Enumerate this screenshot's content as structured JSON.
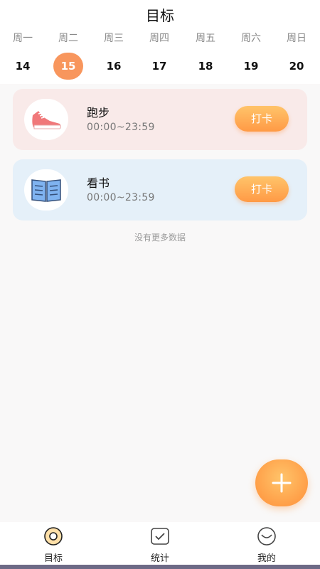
{
  "header": {
    "title": "目标"
  },
  "week": {
    "days": [
      {
        "weekday": "周一",
        "date": "14"
      },
      {
        "weekday": "周二",
        "date": "15"
      },
      {
        "weekday": "周三",
        "date": "16"
      },
      {
        "weekday": "周四",
        "date": "17"
      },
      {
        "weekday": "周五",
        "date": "18"
      },
      {
        "weekday": "周六",
        "date": "19"
      },
      {
        "weekday": "周日",
        "date": "20"
      }
    ],
    "selected_date": "15"
  },
  "goals": [
    {
      "name": "跑步",
      "time": "00:00~23:59",
      "button": "打卡",
      "icon": "sneaker-icon",
      "color": "#f9eae9"
    },
    {
      "name": "看书",
      "time": "00:00~23:59",
      "button": "打卡",
      "icon": "book-icon",
      "color": "#e5f0f9"
    }
  ],
  "list_end_text": "没有更多数据",
  "fab": {
    "icon": "plus-icon"
  },
  "tabbar": {
    "items": [
      {
        "label": "目标",
        "icon": "target-icon",
        "active": true
      },
      {
        "label": "统计",
        "icon": "chart-check-icon",
        "active": false
      },
      {
        "label": "我的",
        "icon": "smile-face-icon",
        "active": false
      }
    ]
  },
  "colors": {
    "accent": "#f8965d",
    "button_top": "#ffc46a",
    "button_bottom": "#ff9a45"
  }
}
